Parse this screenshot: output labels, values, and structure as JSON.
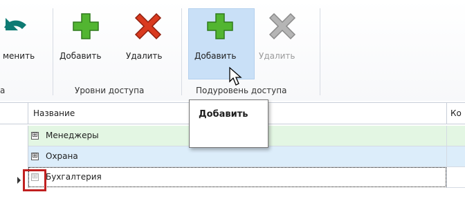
{
  "ribbon": {
    "cut_label": "менить",
    "cut_caption": "а",
    "access_levels": {
      "caption": "Уровни доступа",
      "add_label": "Добавить",
      "delete_label": "Удалить"
    },
    "sublevel": {
      "caption": "Подуровень доступа",
      "add_label": "Добавить",
      "delete_label": "Удалить"
    },
    "icons": {
      "undo": "undo-arrow-icon",
      "add": "green-plus-icon",
      "delete": "red-x-icon",
      "delete_disabled": "gray-x-icon"
    },
    "colors": {
      "add_green": "#52b531",
      "delete_red": "#d93a1f",
      "hover": "#c9e0f7"
    }
  },
  "grid": {
    "columns": [
      "Название",
      "Ко"
    ],
    "rows": [
      {
        "name": "Менеджеры",
        "expander": "⊞"
      },
      {
        "name": "Охрана",
        "expander": "⊞"
      },
      {
        "name": "Бухгалтерия",
        "expander": "⊞"
      }
    ]
  },
  "tooltip": {
    "title": "Добавить"
  }
}
